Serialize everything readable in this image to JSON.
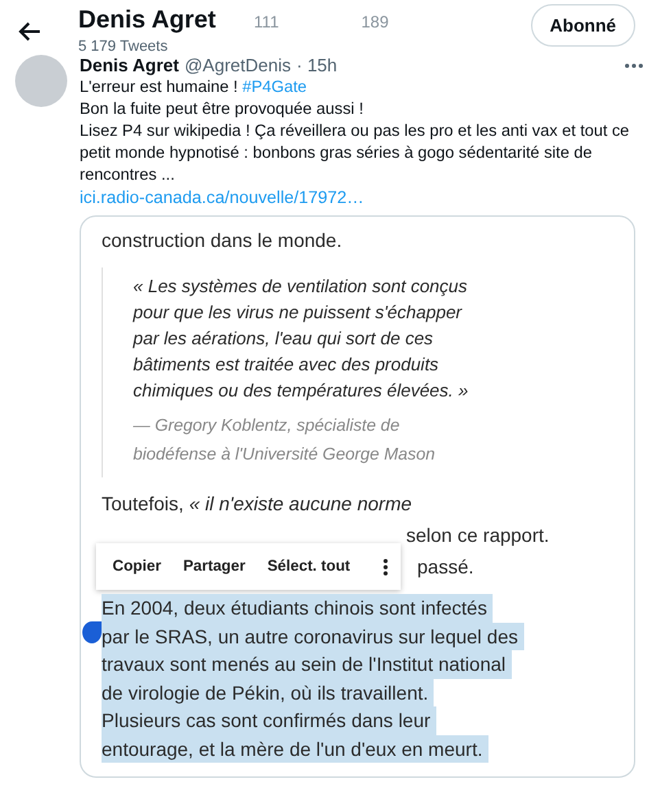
{
  "header": {
    "name": "Denis Agret",
    "tweet_count": "5 179 Tweets",
    "follow_button": "Abonné",
    "faded_stats": [
      "111",
      "189"
    ]
  },
  "tweet": {
    "author": "Denis Agret",
    "handle": "@AgretDenis",
    "time": "· 15h",
    "lines": [
      {
        "text": "L'erreur est humaine ! ",
        "hashtag": "#P4Gate"
      },
      {
        "text": "Bon la fuite peut être provoquée aussi !"
      },
      {
        "text": "Lisez P4 sur wikipedia ! Ça réveillera ou pas les pro et les anti vax et tout ce petit monde hypnotisé : bonbons gras séries à gogo sédentarité site de rencontres ..."
      }
    ],
    "link": "ici.radio-canada.ca/nouvelle/17972…"
  },
  "article": {
    "intro": "construction dans le monde.",
    "quote": "«  Les systèmes de ventilation sont conçus pour que les virus ne puissent s'échapper par les aérations, l'eau qui sort de ces bâtiments est traitée avec des produits chimiques ou des températures élevées.  »",
    "attribution": "— Gregory Koblentz, spécialiste de biodéfense à l'Université George Mason",
    "line_1": "Toutefois, *« il n'existe aucune norme*",
    "line_2_end": "selon ce rapport.",
    "line_3_end": "passé.",
    "menu": [
      "Copier",
      "Partager",
      "Sélect. tout"
    ],
    "selected_lines": [
      "En 2004, deux étudiants chinois sont infectés",
      "par le SRAS, un autre coronavirus sur lequel des",
      "travaux sont menés au sein de l'Institut national",
      "de virologie de Pékin, où ils travaillent.",
      "Plusieurs cas sont confirmés dans leur",
      "entourage, et la mère de l'un d'eux en meurt."
    ]
  }
}
